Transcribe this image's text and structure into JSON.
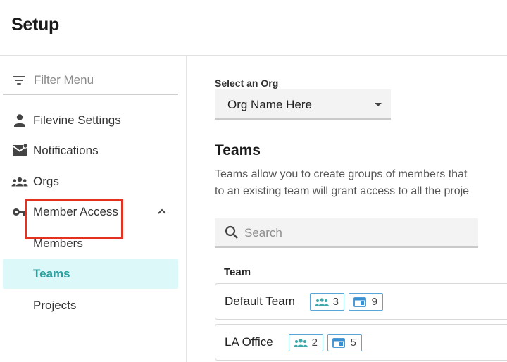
{
  "header": {
    "title": "Setup"
  },
  "sidebar": {
    "filter_placeholder": "Filter Menu",
    "items": [
      {
        "label": "Filevine Settings",
        "icon": "person-icon"
      },
      {
        "label": "Notifications",
        "icon": "mail-icon"
      },
      {
        "label": "Orgs",
        "icon": "group-icon"
      },
      {
        "label": "Member Access",
        "icon": "key-icon",
        "expanded": true
      }
    ],
    "subitems": [
      {
        "label": "Members",
        "active": false
      },
      {
        "label": "Teams",
        "active": true
      },
      {
        "label": "Projects",
        "active": false
      }
    ]
  },
  "main": {
    "org_label": "Select an Org",
    "org_value": "Org Name Here",
    "section_title": "Teams",
    "description_line1": "Teams allow you to create groups of members that",
    "description_line2": "to an existing team will grant access to all the proje",
    "search_placeholder": "Search",
    "column_header": "Team",
    "teams": [
      {
        "name": "Default Team",
        "members": "3",
        "projects": "9"
      },
      {
        "name": "LA Office",
        "members": "2",
        "projects": "5"
      }
    ]
  },
  "colors": {
    "accent": "#2aa1a1",
    "active_bg": "#dcf8f8",
    "highlight": "#e3321f",
    "badge_border": "#5aa6d8"
  }
}
